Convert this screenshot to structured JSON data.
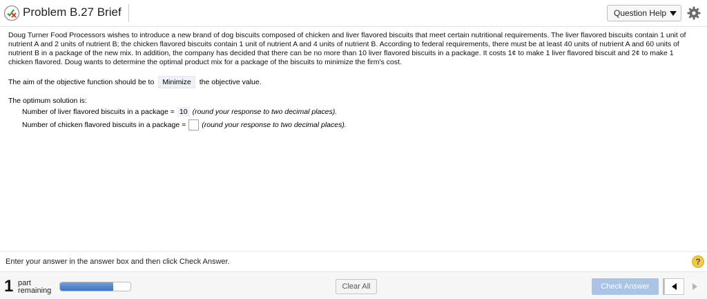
{
  "header": {
    "title": "Problem B.27 Brief",
    "question_help_label": "Question Help",
    "status_icon": "partially-correct-icon",
    "settings_icon": "gear-icon"
  },
  "problem": {
    "text": "Doug Turner Food Processors wishes to introduce a new brand of dog biscuits composed of chicken and liver flavored biscuits that meet certain nutritional requirements.  The liver flavored biscuits contain 1 unit of nutrient A and 2 units of nutrient B; the chicken flavored biscuits contain 1 unit of nutrient A and 4 units of nutrient B.  According to federal requirements, there must be at least 40 units of nutrient A and 60 units of nutrient B in a package of the new mix.  In addition, the company has decided that there can be no more than 10 liver flavored biscuits in a package.  It costs 1¢ to make 1 liver flavored biscuit and 2¢ to make 1 chicken flavored.  Doug wants to determine the optimal product mix for a package of the biscuits to minimize the firm's cost."
  },
  "objective": {
    "prefix": "The aim of the objective function should be to",
    "selected": "Minimize",
    "suffix": "the objective value."
  },
  "solution": {
    "heading": "The optimum solution is:",
    "liver_label": "Number of liver flavored biscuits in a package =",
    "liver_value": "10",
    "liver_hint": "(round your response to two decimal places).",
    "chicken_label": "Number of chicken flavored biscuits in a package =",
    "chicken_value": "",
    "chicken_hint": "(round your response to two decimal places)."
  },
  "instructions": "Enter your answer in the answer box and then click Check Answer.",
  "help_symbol": "?",
  "footer": {
    "parts_remaining_count": "1",
    "parts_remaining_line1": "part",
    "parts_remaining_line2": "remaining",
    "progress_fraction": 0.75,
    "clear_all_label": "Clear All",
    "check_answer_label": "Check Answer"
  },
  "colors": {
    "check_answer_bg": "#a9c4e6",
    "progress_fill": "#3e74c4",
    "help_icon": "#f2c94c"
  }
}
